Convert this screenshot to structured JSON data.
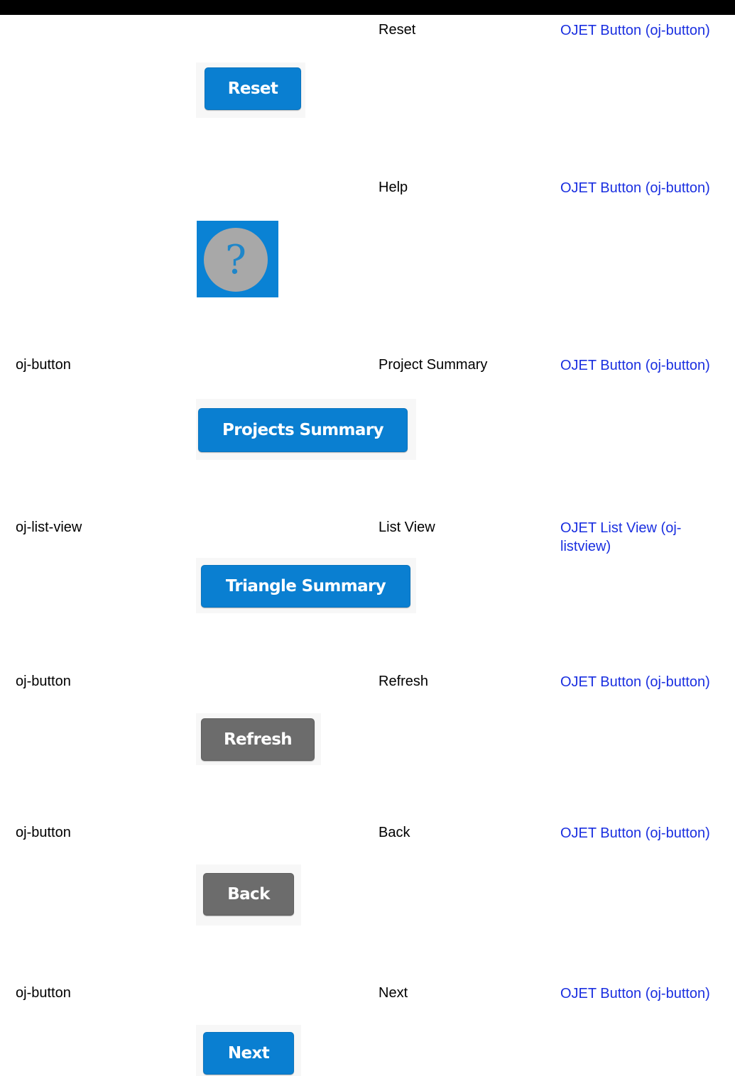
{
  "rows": [
    {
      "component": "",
      "name": "Reset",
      "link": "OJET Button (oj-button)",
      "button_label": "Reset",
      "button_color": "#0a7fd1"
    },
    {
      "component": "",
      "name": "Help",
      "link": "OJET Button (oj-button)",
      "icon": "help-question-icon",
      "icon_glyph": "?",
      "button_color": "#0a82d4"
    },
    {
      "component": "oj-button",
      "name": "Project Summary",
      "link": "OJET Button (oj-button)",
      "button_label": "Projects Summary",
      "button_color": "#0a7fd1"
    },
    {
      "component": "oj-list-view",
      "name": "List View",
      "link": "OJET List View (oj-listview)",
      "button_label": "Triangle Summary",
      "button_color": "#0a7fd1"
    },
    {
      "component": "oj-button",
      "name": "Refresh",
      "link": "OJET Button (oj-button)",
      "button_label": "Refresh",
      "button_color": "#6c6c6c"
    },
    {
      "component": "oj-button",
      "name": "Back",
      "link": "OJET Button (oj-button)",
      "button_label": "Back",
      "button_color": "#6c6c6c"
    },
    {
      "component": "oj-button",
      "name": "Next",
      "link": "OJET Button (oj-button)",
      "button_label": "Next",
      "button_color": "#0a7fd1"
    }
  ],
  "colors": {
    "link": "#1a2fe0",
    "top_rule": "#000000"
  }
}
